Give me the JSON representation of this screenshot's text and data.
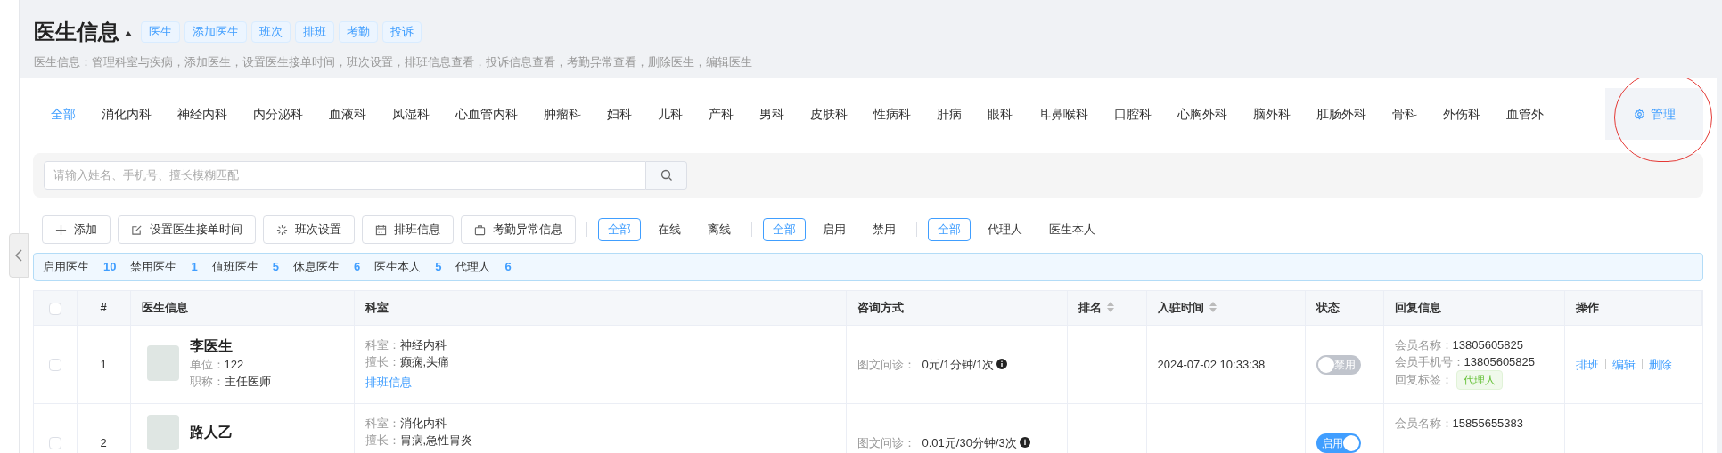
{
  "header": {
    "title": "医生信息",
    "tags": [
      "医生",
      "添加医生",
      "班次",
      "排班",
      "考勤",
      "投诉"
    ],
    "description": "医生信息：管理科室与疾病，添加医生，设置医生接单时间，班次设置，排班信息查看，投诉信息查看，考勤异常查看，删除医生，编辑医生"
  },
  "dept_tabs": [
    {
      "label": "全部",
      "selected": true
    },
    {
      "label": "消化内科",
      "selected": false
    },
    {
      "label": "神经内科",
      "selected": false
    },
    {
      "label": "内分泌科",
      "selected": false
    },
    {
      "label": "血液科",
      "selected": false
    },
    {
      "label": "风湿科",
      "selected": false
    },
    {
      "label": "心血管内科",
      "selected": false
    },
    {
      "label": "肿瘤科",
      "selected": false
    },
    {
      "label": "妇科",
      "selected": false
    },
    {
      "label": "儿科",
      "selected": false
    },
    {
      "label": "产科",
      "selected": false
    },
    {
      "label": "男科",
      "selected": false
    },
    {
      "label": "皮肤科",
      "selected": false
    },
    {
      "label": "性病科",
      "selected": false
    },
    {
      "label": "肝病",
      "selected": false
    },
    {
      "label": "眼科",
      "selected": false
    },
    {
      "label": "耳鼻喉科",
      "selected": false
    },
    {
      "label": "口腔科",
      "selected": false
    },
    {
      "label": "心胸外科",
      "selected": false
    },
    {
      "label": "脑外科",
      "selected": false
    },
    {
      "label": "肛肠外科",
      "selected": false
    },
    {
      "label": "骨科",
      "selected": false
    },
    {
      "label": "外伤科",
      "selected": false
    },
    {
      "label": "血管外",
      "selected": false
    }
  ],
  "manage_button": {
    "label": "管理"
  },
  "search": {
    "placeholder": "请输入姓名、手机号、擅长模糊匹配"
  },
  "toolbar_buttons": [
    {
      "kind": "add",
      "label": "添加"
    },
    {
      "kind": "edit",
      "label": "设置医生接单时间"
    },
    {
      "kind": "spinner",
      "label": "班次设置"
    },
    {
      "kind": "calendar",
      "label": "排班信息"
    },
    {
      "kind": "briefcase",
      "label": "考勤异常信息"
    }
  ],
  "filter_groups": [
    [
      {
        "label": "全部",
        "selected": true
      },
      {
        "label": "在线",
        "selected": false
      },
      {
        "label": "离线",
        "selected": false
      }
    ],
    [
      {
        "label": "全部",
        "selected": true
      },
      {
        "label": "启用",
        "selected": false
      },
      {
        "label": "禁用",
        "selected": false
      }
    ],
    [
      {
        "label": "全部",
        "selected": true
      },
      {
        "label": "代理人",
        "selected": false
      },
      {
        "label": "医生本人",
        "selected": false
      }
    ]
  ],
  "stats": [
    {
      "label": "启用医生",
      "value": "10"
    },
    {
      "label": "禁用医生",
      "value": "1"
    },
    {
      "label": "值班医生",
      "value": "5"
    },
    {
      "label": "休息医生",
      "value": "6"
    },
    {
      "label": "医生本人",
      "value": "5"
    },
    {
      "label": "代理人",
      "value": "6"
    }
  ],
  "table": {
    "select_all_checked": false,
    "columns": [
      {
        "label": "#",
        "sortable": false
      },
      {
        "label": "医生信息",
        "sortable": false
      },
      {
        "label": "科室",
        "sortable": false
      },
      {
        "label": "咨询方式",
        "sortable": false
      },
      {
        "label": "排名",
        "sortable": true
      },
      {
        "label": "入驻时间",
        "sortable": true
      },
      {
        "label": "状态",
        "sortable": false
      },
      {
        "label": "回复信息",
        "sortable": false
      },
      {
        "label": "操作",
        "sortable": false
      }
    ],
    "rows": [
      {
        "checked": false,
        "index": "1",
        "name": "李医生",
        "unit_label": "单位：",
        "unit": "122",
        "title_label": "职称：",
        "title": "主任医师",
        "dept_label": "科室：",
        "dept": "神经内科",
        "skill_label": "擅长：",
        "skill": "癫痫,头痛",
        "schedule_link": "排班信息",
        "consult_label": "图文问诊：",
        "consult": "0元/1分钟/1次",
        "joined": "2024-07-02 10:33:38",
        "status": {
          "on": false,
          "label": "禁用"
        },
        "reply": [
          {
            "label": "会员名称：",
            "value": "13805605825"
          },
          {
            "label": "会员手机号：",
            "value": "13805605825"
          }
        ],
        "reply_tag_label": "回复标签：",
        "reply_tag": "代理人",
        "actions": [
          "排班",
          "编辑",
          "删除"
        ]
      },
      {
        "checked": false,
        "index": "2",
        "name": "路人乙",
        "dept_label": "科室：",
        "dept": "消化内科",
        "skill_label": "擅长：",
        "skill": "胃病,急性胃炎",
        "consult_label": "图文问诊：",
        "consult": "0.01元/30分钟/3次",
        "status": {
          "on": true,
          "label": "启用"
        },
        "reply": [
          {
            "label": "会员名称：",
            "value": "15855655383"
          }
        ]
      }
    ]
  }
}
